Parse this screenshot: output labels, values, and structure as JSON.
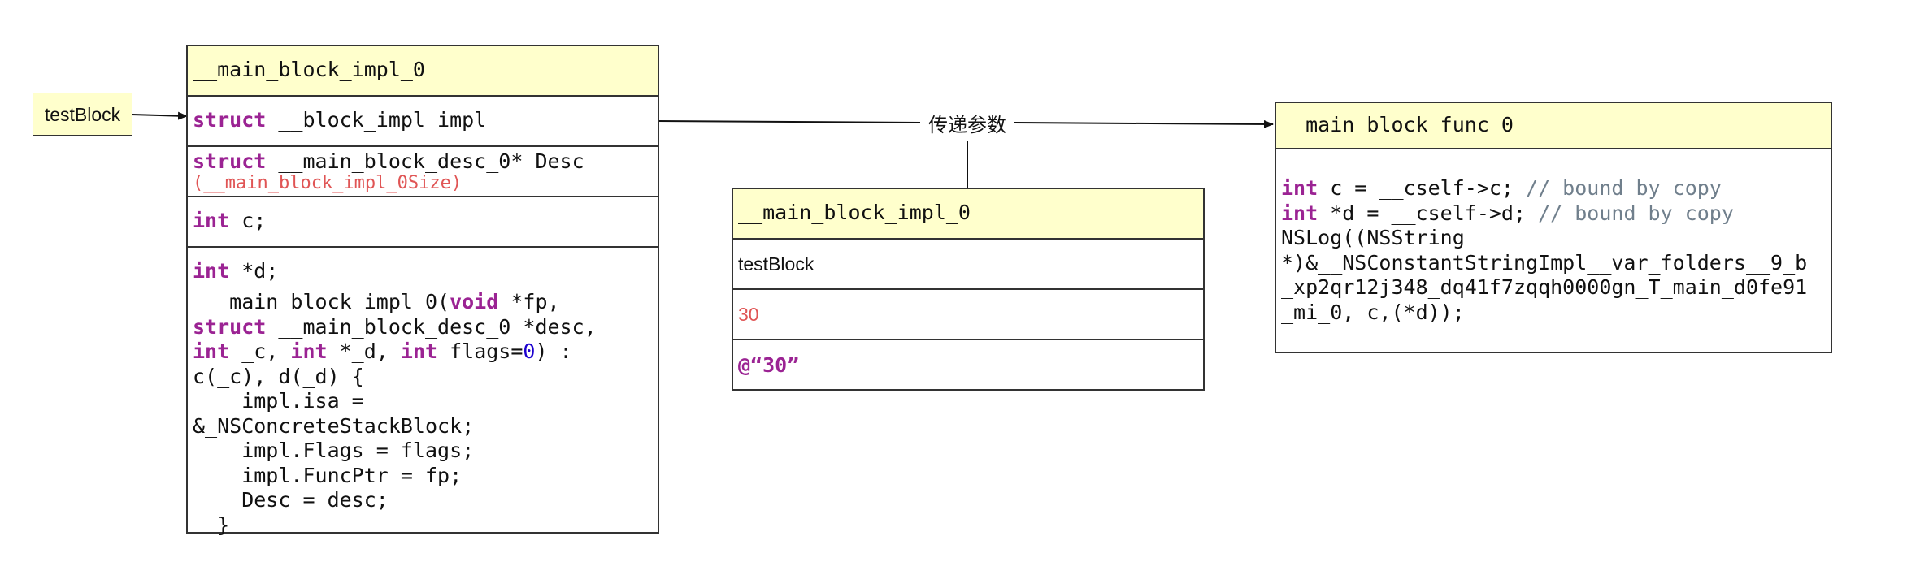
{
  "testblock_node": {
    "label": "testBlock"
  },
  "left_struct": {
    "title": "__main_block_impl_0",
    "impl_kw": "struct",
    "impl_rest": " __block_impl impl",
    "desc_kw": "struct",
    "desc_rest": " __main_block_desc_0* Desc",
    "desc_size": "(__main_block_impl_0Size)",
    "c_kw": "int",
    "c_rest": " c;",
    "d_kw": "int",
    "d_rest": " *d;",
    "ctor": {
      "l1_a": " __main_block_impl_0(",
      "l1_kw": "void",
      "l1_b": " *fp,",
      "l2_kw": "struct",
      "l2_b": " __main_block_desc_0 *desc,",
      "l3_kw1": "int",
      "l3_a": " _c, ",
      "l3_kw2": "int",
      "l3_b": " *_d, ",
      "l3_kw3": "int",
      "l3_c": " flags=",
      "l3_num": "0",
      "l3_d": ") :",
      "l4": "c(_c), d(_d) {",
      "l5": "    impl.isa =",
      "l6": "&_NSConcreteStackBlock;",
      "l7": "    impl.Flags = flags;",
      "l8": "    impl.FuncPtr = fp;",
      "l9": "    Desc = desc;",
      "l10": "  }"
    }
  },
  "param_label": "传递参数",
  "mid_struct": {
    "title": "__main_block_impl_0",
    "row1": "testBlock",
    "row2": "30",
    "row3": "@“30”"
  },
  "func_struct": {
    "title": "__main_block_func_0",
    "l1_kw": "int",
    "l1_a": " c = __cself->c; ",
    "l1_cmt": "// bound by copy",
    "l2_kw": "int",
    "l2_a": " *d = __cself->d; ",
    "l2_cmt": "// bound by copy",
    "l3": "NSLog((NSString",
    "l4": "*)&__NSConstantStringImpl__var_folders__9_b",
    "l5": "_xp2qr12j348_dq41f7zqqh0000gn_T_main_d0fe91",
    "l6": "_mi_0, c,(*d));"
  },
  "colors": {
    "header_fill": "#ffffcc",
    "keyword": "#9b2393",
    "number": "#1c00cf",
    "comment": "#707f8c",
    "red_text": "#e05555"
  }
}
